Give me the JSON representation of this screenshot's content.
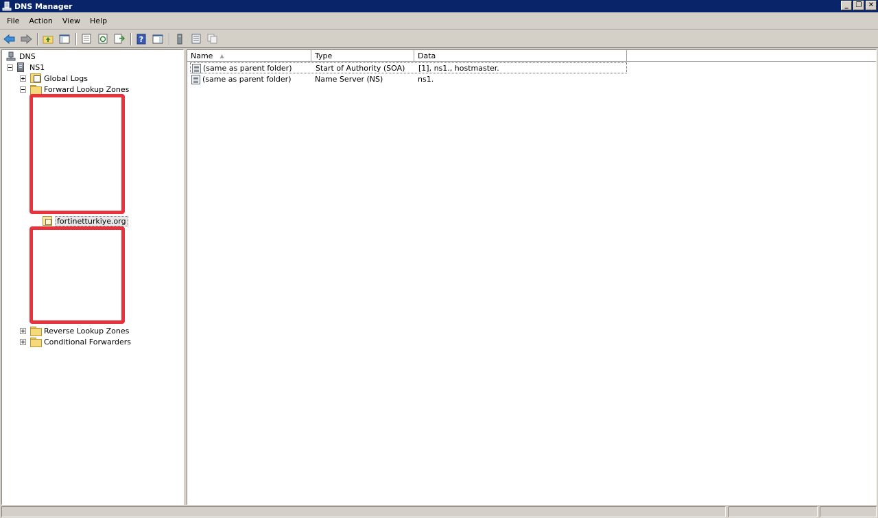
{
  "window": {
    "title": "DNS Manager"
  },
  "window_controls": {
    "minimize": "_",
    "restore": "❐",
    "close": "✕"
  },
  "menu": [
    "File",
    "Action",
    "View",
    "Help"
  ],
  "toolbar": {
    "buttons": [
      "back-arrow-icon",
      "forward-arrow-icon",
      "up-folder-icon",
      "show-hide-console-tree-icon",
      "properties-icon",
      "refresh-icon",
      "export-list-icon",
      "help-icon",
      "action-pane-icon",
      "server-icon",
      "list-view-icon",
      "copy-icon"
    ]
  },
  "tree": {
    "root": "DNS",
    "server": "NS1",
    "global_logs": "Global Logs",
    "forward_zones": "Forward Lookup Zones",
    "zone": "fortinetturkiye.org",
    "reverse_zones": "Reverse Lookup Zones",
    "conditional_forwarders": "Conditional Forwarders"
  },
  "list": {
    "columns": [
      "Name",
      "Type",
      "Data"
    ],
    "sort_column": "Name",
    "rows": [
      {
        "name": "(same as parent folder)",
        "type": "Start of Authority (SOA)",
        "data": "[1], ns1., hostmaster."
      },
      {
        "name": "(same as parent folder)",
        "type": "Name Server (NS)",
        "data": "ns1."
      }
    ]
  },
  "colors": {
    "title_bar": "#0a246a",
    "redaction": "#e8323c",
    "chrome": "#d4d0c8"
  }
}
